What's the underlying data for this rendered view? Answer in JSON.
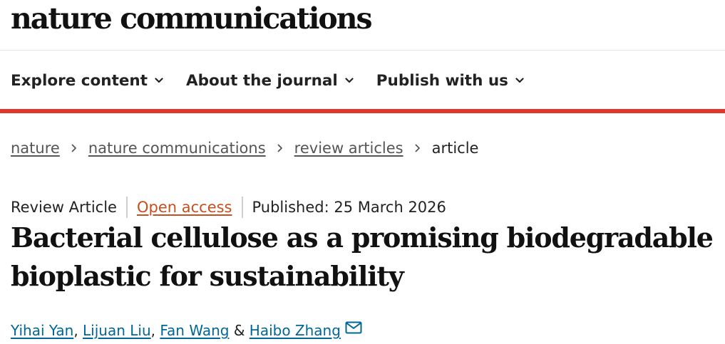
{
  "header": {
    "brand": "nature communications"
  },
  "nav": {
    "items": [
      {
        "label": "Explore content",
        "icon": "chevron-down-icon"
      },
      {
        "label": "About the journal",
        "icon": "chevron-down-icon"
      },
      {
        "label": "Publish with us",
        "icon": "chevron-down-icon"
      }
    ]
  },
  "breadcrumb": {
    "items": [
      "nature",
      "nature communications",
      "review articles"
    ],
    "current": "article"
  },
  "meta": {
    "article_type": "Review Article",
    "access": "Open access",
    "published": "Published: 25 March 2026"
  },
  "article": {
    "title": "Bacterial cellulose as a promising biodegradable bioplastic for sustainability"
  },
  "authors": {
    "list": [
      "Yihai Yan",
      "Lijuan Liu",
      "Fan Wang",
      "Haibo Zhang"
    ],
    "separator_comma": ",",
    "separator_and": "&",
    "contact_icon": "mail-icon"
  },
  "colors": {
    "accent_red": "#e2362d",
    "open_access": "#c4501f",
    "author_link": "#006699"
  }
}
